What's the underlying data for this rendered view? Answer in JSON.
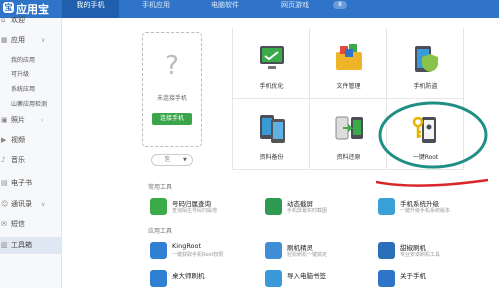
{
  "app": {
    "logo_text": "应用宝",
    "logo_mark": "宝"
  },
  "nav": {
    "tabs": [
      {
        "label": "我的手机",
        "active": true
      },
      {
        "label": "手机应用",
        "active": false
      },
      {
        "label": "电脑软件",
        "active": false
      },
      {
        "label": "网页游戏",
        "active": false
      }
    ],
    "badge": "8"
  },
  "sidebar": {
    "top_label": "欢迎",
    "items": [
      {
        "label": "应用",
        "icon": "apps-icon",
        "chev": "∨"
      },
      {
        "label": "照片",
        "icon": "photo-icon",
        "chev": "›"
      },
      {
        "label": "视频",
        "icon": "video-icon",
        "chev": ""
      },
      {
        "label": "音乐",
        "icon": "music-icon",
        "chev": ""
      },
      {
        "label": "电子书",
        "icon": "ebook-icon",
        "chev": ""
      },
      {
        "label": "通讯录",
        "icon": "contacts-icon",
        "chev": "∨"
      },
      {
        "label": "短信",
        "icon": "sms-icon",
        "chev": ""
      },
      {
        "label": "工具箱",
        "icon": "toolbox-icon",
        "chev": ""
      }
    ],
    "app_sub": [
      "我的应用",
      "可升级",
      "系统应用",
      "山寨应用检测"
    ]
  },
  "phone": {
    "question": "?",
    "message": "未连接手机",
    "connect_button": "连接手机",
    "dropdown_icon": "⎘",
    "dropdown_arrow": "▼"
  },
  "tools": [
    {
      "label": "手机优化"
    },
    {
      "label": "文件管理"
    },
    {
      "label": "手机防盗"
    },
    {
      "label": "资料备份"
    },
    {
      "label": "资料还原"
    },
    {
      "label": "一键Root"
    }
  ],
  "sections": {
    "common": "常用工具",
    "apps": "应用工具"
  },
  "common_tools": [
    {
      "name": "号码归属查询",
      "desc": "查询陌生号码归属地",
      "color": "#3bab4a"
    },
    {
      "name": "动态截屏",
      "desc": "手机屏幕实时截图",
      "color": "#2f9a52"
    },
    {
      "name": "手机系统升级",
      "desc": "一键升级手机系统版本",
      "color": "#3aa0d8"
    }
  ],
  "app_tools": [
    {
      "name": "KingRoot",
      "desc": "一键获取手机Root权限",
      "color": "#2f7fd2"
    },
    {
      "name": "刷机精灵",
      "desc": "轻松刷机一键搞定",
      "color": "#3f8ed6"
    },
    {
      "name": "甜椒刷机",
      "desc": "专业安卓刷机工具",
      "color": "#2b6fb8"
    },
    {
      "name": "桌大师刷机",
      "desc": "",
      "color": "#2f7fd2"
    },
    {
      "name": "导入电脑书签",
      "desc": "",
      "color": "#3a9ad8"
    },
    {
      "name": "关于手机",
      "desc": "",
      "color": "#2f74c8"
    }
  ]
}
